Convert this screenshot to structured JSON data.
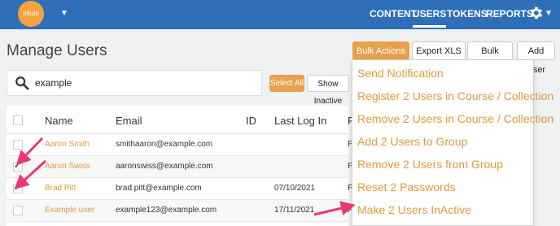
{
  "brand": {
    "logo_text": "Intuto",
    "accent": "#2f6fb9",
    "orange": "#e39a3b"
  },
  "nav": {
    "items": [
      {
        "label": "CONTENT"
      },
      {
        "label": "USERS"
      },
      {
        "label": "TOKENS"
      },
      {
        "label": "REPORTS"
      }
    ],
    "active": "USERS"
  },
  "page": {
    "title": "Manage Users"
  },
  "toolbar": {
    "bulk_actions": "Bulk Actions",
    "export": "Export XLS",
    "bulk_upload": "Bulk Upload",
    "add_user": "Add User"
  },
  "search": {
    "value": "example",
    "select_all": "Select All",
    "show_inactive": "Show Inactive"
  },
  "table": {
    "headers": {
      "name": "Name",
      "email": "Email",
      "id": "ID",
      "last_login": "Last Log In",
      "status": "R"
    },
    "rows": [
      {
        "name": "Aaron Smith",
        "email": "smithaaron@example.com",
        "last_login": "",
        "status": "P",
        "checked": false
      },
      {
        "name": "Aaron Swiss",
        "email": "aaronswiss@example.com",
        "last_login": "",
        "status": "P",
        "checked": true
      },
      {
        "name": "Brad Pitt",
        "email": "brad.pitt@example.com",
        "last_login": "07/10/2021",
        "status": "P",
        "checked": true
      },
      {
        "name": "Example user",
        "email": "example123@example.com",
        "last_login": "17/11/2021",
        "status": "P",
        "checked": false
      }
    ]
  },
  "dropdown": {
    "items": [
      "Send Notification",
      "Register 2 Users in Course / Collection",
      "Remove 2 Users in Course / Collection",
      "Add 2 Users to Group",
      "Remove 2 Users from Group",
      "Reset 2 Passwords",
      "Make 2 Users InActive"
    ]
  },
  "annotation_color": "#e8386e"
}
